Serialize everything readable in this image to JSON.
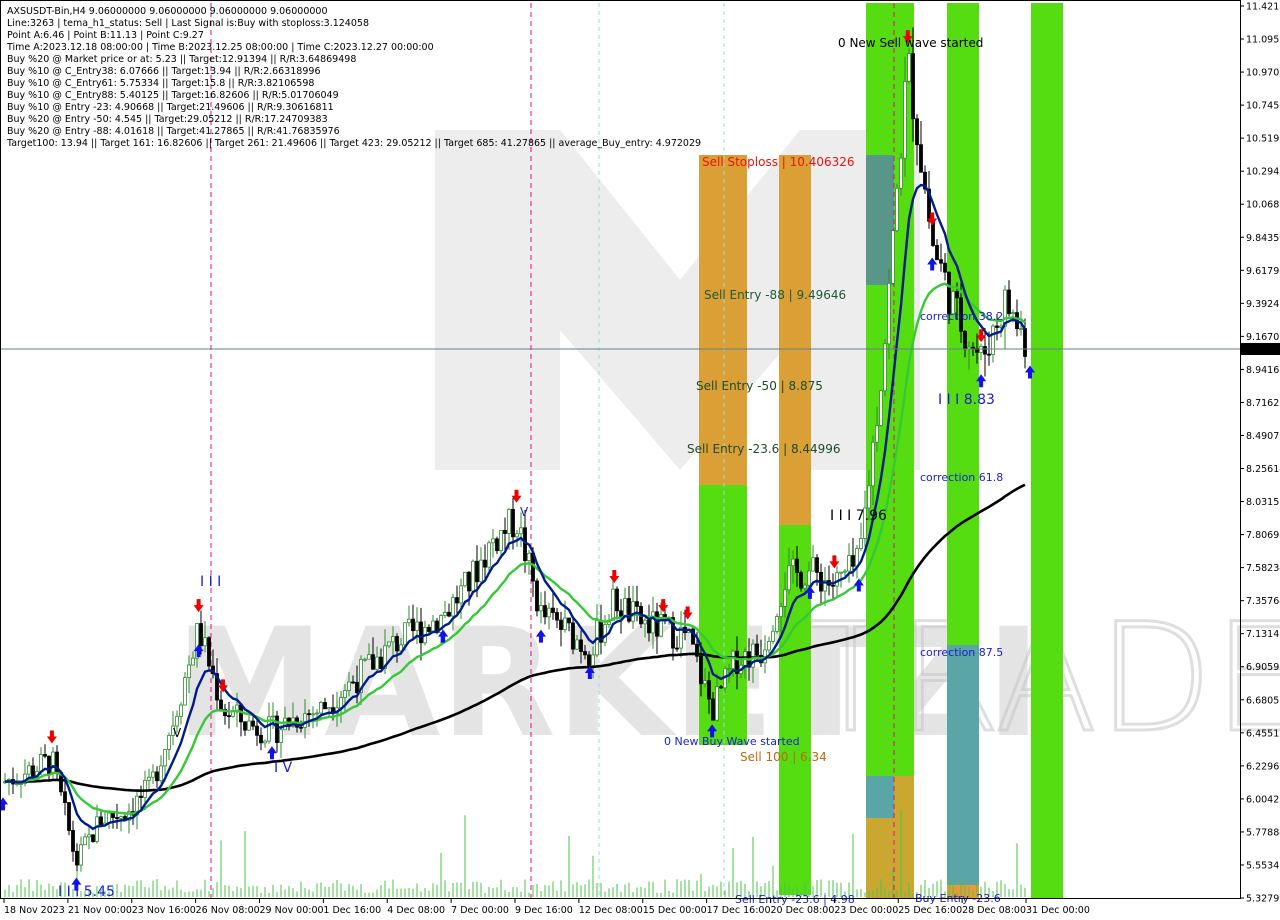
{
  "header": {
    "lines": [
      "AXSUSDT-Bin,H4  9.06000000 9.06000000 9.06000000 9.06000000",
      "Line:3263  | tema_h1_status: Sell  | Last Signal is:Buy with stoploss:3.124058",
      "Point A:6.46  | Point B:11.13  | Point C:9.27",
      "Time A:2023.12.18 08:00:00  | Time B:2023.12.25 08:00:00  | Time C:2023.12.27 00:00:00",
      "Buy %20 @ Market price or at: 5.23  || Target:12.91394  || R/R:3.64869498",
      "Buy %10 @ C_Entry38: 6.07666  || Target:13.94  || R/R:2.66318996",
      "Buy %10 @ C_Entry61: 5.75334  || Target:15.8  || R/R:3.82106598",
      "Buy %10 @ C_Entry88: 5.40125  || Target:16.82606  || R/R:5.01706049",
      "Buy %10 @ Entry -23: 4.90668  || Target:21.49606  || R/R:9.30616811",
      "Buy %20 @ Entry -50: 4.545  || Target:29.05212  || R/R:17.24709383",
      "Buy %20 @ Entry -88: 4.01618  || Target:41.27865  || R/R:41.76835976",
      "Target100: 13.94  || Target 161: 16.82606  || Target 261: 21.49606  || Target 423: 29.05212  || Target 685: 41.27865  || average_Buy_entry: 4.972029"
    ]
  },
  "price_axis": {
    "ticks": [
      "11.42130",
      "11.09590",
      "10.97050",
      "10.74510",
      "10.51970",
      "10.29430",
      "10.06890",
      "9.84350",
      "9.61790",
      "9.39245",
      "9.16705",
      "8.94165",
      "8.71621",
      "8.49079",
      "8.25614",
      "8.03158",
      "7.80698",
      "7.58234",
      "7.35764",
      "7.13140",
      "6.90596",
      "6.68053",
      "6.45512",
      "6.22969",
      "6.00427",
      "5.77884",
      "5.55341",
      "5.32799"
    ],
    "current_price": "9.06000"
  },
  "time_axis": {
    "ticks": [
      "18 Nov 2023",
      "21 Nov 00:00",
      "23 Nov 16:00",
      "26 Nov 08:00",
      "29 Nov 00:00",
      "1 Dec 16:00",
      "4 Dec 08:00",
      "7 Dec 00:00",
      "9 Dec 16:00",
      "12 Dec 08:00",
      "15 Dec 00:00",
      "17 Dec 16:00",
      "20 Dec 08:00",
      "23 Dec 00:00",
      "25 Dec 16:00",
      "28 Dec 08:00",
      "31 Dec 00:00"
    ]
  },
  "annotations": {
    "sell_stoploss": "Sell Stoploss | 10.406326",
    "sell_entry_88": "Sell Entry -88 | 9.49646",
    "sell_entry_50": "Sell Entry -50 | 8.875",
    "sell_entry_23": "Sell Entry -23.6 | 8.44996",
    "sell_100": "Sell 100 | 6.34",
    "new_sell_wave": "0 New Sell wave started",
    "new_buy_wave": "0 New Buy Wave started",
    "correction_382": "correction 38.2",
    "correction_618": "correction 61.8",
    "correction_875": "correction 87.5",
    "wave_883": "I I I 8.83",
    "wave_796": "I I I 7.96",
    "wave_545": "I I I 5.45",
    "wave_iii_top": "I I I",
    "wave_iv": "I V",
    "wave_v": "V",
    "wave_v2": "V",
    "buy_entry_bottom": "Buy Entry -23.6",
    "sell_entry_bottom": "Sell Entry -23.6 | 4.98"
  },
  "watermark": {
    "left": "MARKETZI",
    "right": "TRADE"
  },
  "colors": {
    "bg": "#ffffff",
    "bull_candle": "#2e8b2e",
    "bear_candle": "#000000",
    "green_band": "#55dd11",
    "orange_band": "#e69a3a",
    "teal_band": "#5aa5a5",
    "ma_blue": "#001c8a",
    "ma_green": "#35c935",
    "ma_black": "#000000",
    "buy_arrow": "#1111ee",
    "sell_arrow": "#ee0000"
  },
  "chart_data": {
    "type": "candlestick",
    "symbol": "AXSUSDT-Bin",
    "timeframe": "H4",
    "ylim": [
      5.32799,
      11.4213
    ],
    "x_range": [
      "2023-11-18",
      "2023-12-31"
    ],
    "points": [
      {
        "date": "2023-11-18",
        "close": 6.1
      },
      {
        "date": "2023-11-20",
        "close": 6.25
      },
      {
        "date": "2023-11-21",
        "close": 5.55
      },
      {
        "date": "2023-11-22",
        "close": 5.85
      },
      {
        "date": "2023-11-23",
        "close": 5.9
      },
      {
        "date": "2023-11-24",
        "close": 6.05
      },
      {
        "date": "2023-11-25",
        "close": 6.55
      },
      {
        "date": "2023-11-26",
        "close": 7.15
      },
      {
        "date": "2023-11-27",
        "close": 6.6
      },
      {
        "date": "2023-11-28",
        "close": 6.5
      },
      {
        "date": "2023-11-29",
        "close": 6.45
      },
      {
        "date": "2023-11-30",
        "close": 6.55
      },
      {
        "date": "2023-12-01",
        "close": 6.6
      },
      {
        "date": "2023-12-02",
        "close": 6.75
      },
      {
        "date": "2023-12-03",
        "close": 6.9
      },
      {
        "date": "2023-12-04",
        "close": 7.05
      },
      {
        "date": "2023-12-05",
        "close": 7.15
      },
      {
        "date": "2023-12-06",
        "close": 7.25
      },
      {
        "date": "2023-12-07",
        "close": 7.45
      },
      {
        "date": "2023-12-08",
        "close": 7.75
      },
      {
        "date": "2023-12-09",
        "close": 7.9
      },
      {
        "date": "2023-12-10",
        "close": 7.25
      },
      {
        "date": "2023-12-11",
        "close": 7.15
      },
      {
        "date": "2023-12-12",
        "close": 7.0
      },
      {
        "date": "2023-12-13",
        "close": 7.35
      },
      {
        "date": "2023-12-14",
        "close": 7.2
      },
      {
        "date": "2023-12-15",
        "close": 7.15
      },
      {
        "date": "2023-12-16",
        "close": 7.1
      },
      {
        "date": "2023-12-17",
        "close": 6.6
      },
      {
        "date": "2023-12-18",
        "close": 6.95
      },
      {
        "date": "2023-12-19",
        "close": 7.0
      },
      {
        "date": "2023-12-20",
        "close": 7.5
      },
      {
        "date": "2023-12-21",
        "close": 7.55
      },
      {
        "date": "2023-12-22",
        "close": 7.45
      },
      {
        "date": "2023-12-23",
        "close": 7.6
      },
      {
        "date": "2023-12-24",
        "close": 9.0
      },
      {
        "date": "2023-12-25",
        "close": 11.05
      },
      {
        "date": "2023-12-26",
        "close": 9.8
      },
      {
        "date": "2023-12-27",
        "close": 9.3
      },
      {
        "date": "2023-12-28",
        "close": 9.0
      },
      {
        "date": "2023-12-29",
        "close": 9.4
      },
      {
        "date": "2023-12-30",
        "close": 9.06
      }
    ],
    "grid": false,
    "legend": "none"
  }
}
